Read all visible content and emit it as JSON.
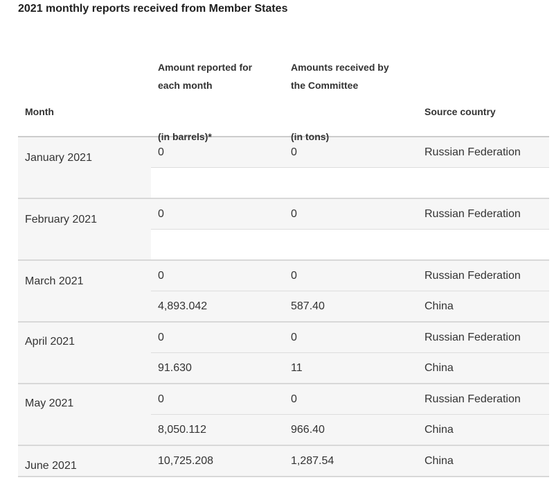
{
  "title": "2021 monthly reports received from Member States",
  "headers": {
    "month": "Month",
    "amount_line1": "Amount reported for",
    "amount_line2": "each month",
    "amount_unit": "(in barrels)*",
    "received_line1": "Amounts received by",
    "received_line2": "the Committee",
    "received_unit": "(in tons)",
    "source": "Source country"
  },
  "groups": [
    {
      "month": "January 2021",
      "rows": [
        {
          "amount": "0",
          "received": "0",
          "source": "Russian Federation"
        },
        {
          "amount": "",
          "received": "",
          "source": ""
        }
      ]
    },
    {
      "month": "February 2021",
      "rows": [
        {
          "amount": "0",
          "received": "0",
          "source": "Russian Federation"
        },
        {
          "amount": "",
          "received": "",
          "source": ""
        }
      ]
    },
    {
      "month": "March 2021",
      "rows": [
        {
          "amount": "0",
          "received": "0",
          "source": "Russian Federation"
        },
        {
          "amount": "4,893.042",
          "received": "587.40",
          "source": "China"
        }
      ]
    },
    {
      "month": "April 2021",
      "rows": [
        {
          "amount": "0",
          "received": "0",
          "source": "Russian Federation"
        },
        {
          "amount": "91.630",
          "received": "11",
          "source": "China"
        }
      ]
    },
    {
      "month": "May 2021",
      "rows": [
        {
          "amount": "0",
          "received": "0",
          "source": "Russian Federation"
        },
        {
          "amount": "8,050.112",
          "received": "966.40",
          "source": "China"
        }
      ]
    },
    {
      "month": "June 2021",
      "rows": [
        {
          "amount": "10,725.208",
          "received": "1,287.54",
          "source": "China"
        }
      ]
    }
  ]
}
